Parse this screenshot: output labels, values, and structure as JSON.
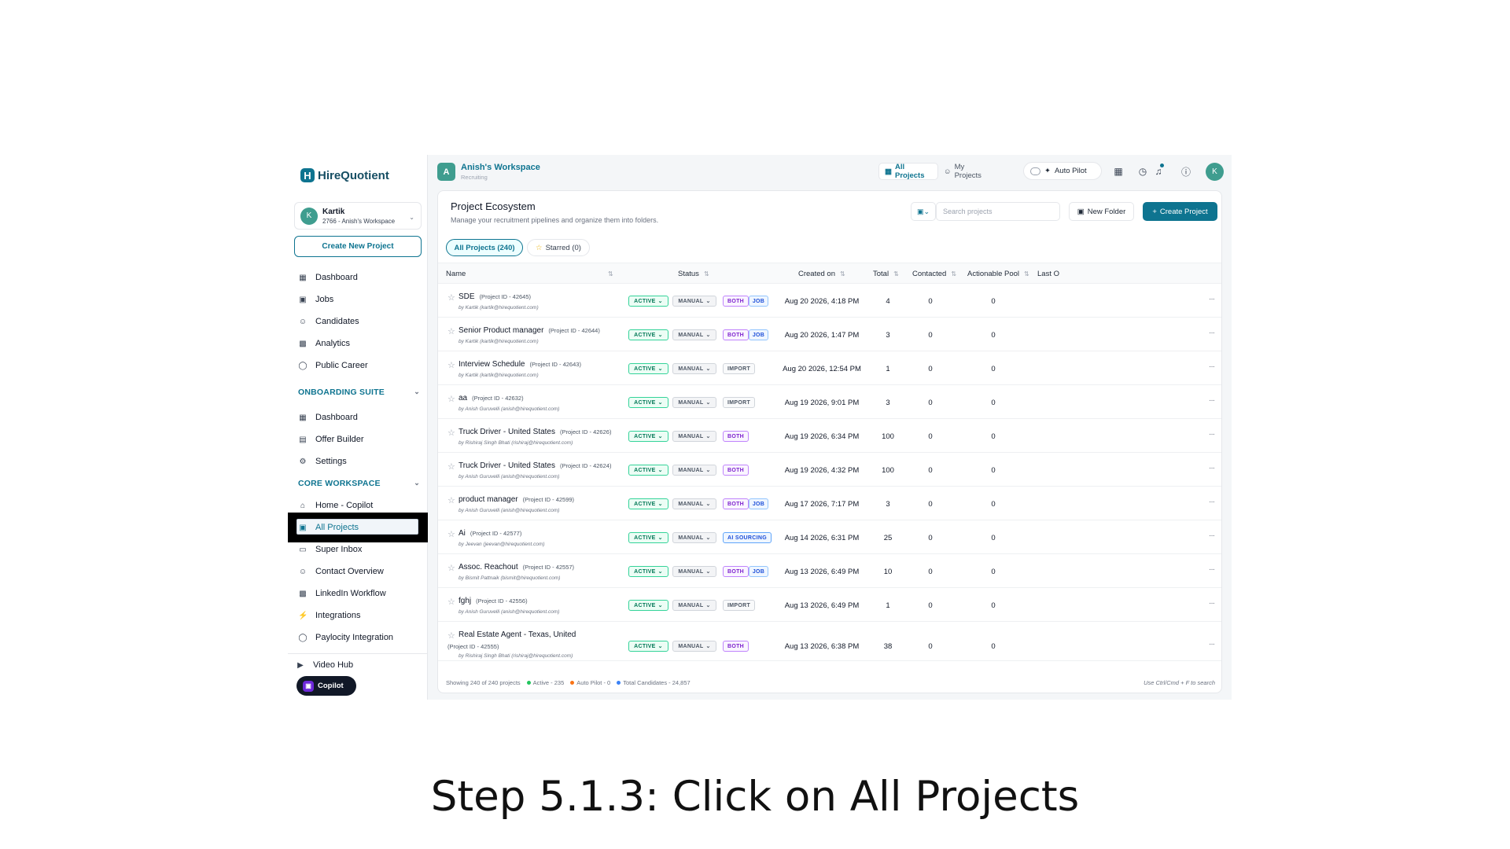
{
  "brand": {
    "name": "HireQuotient",
    "logo_letter": "H"
  },
  "account": {
    "avatar": "K",
    "name": "Kartik",
    "workspace": "2766 - Anish's Workspace"
  },
  "sidebar": {
    "create_button": "Create New Project",
    "main_items": [
      {
        "label": "Dashboard",
        "icon": "grid-icon"
      },
      {
        "label": "Jobs",
        "icon": "briefcase-icon"
      },
      {
        "label": "Candidates",
        "icon": "users-icon"
      },
      {
        "label": "Analytics",
        "icon": "bar-chart-icon"
      },
      {
        "label": "Public Career",
        "icon": "globe-icon"
      }
    ],
    "onboarding_title": "ONBOARDING SUITE",
    "onboarding_items": [
      {
        "label": "Dashboard",
        "icon": "grid-icon"
      },
      {
        "label": "Offer Builder",
        "icon": "document-icon"
      },
      {
        "label": "Settings",
        "icon": "gear-icon"
      }
    ],
    "core_title": "CORE WORKSPACE",
    "core_items": [
      {
        "label": "Home - Copilot",
        "icon": "home-icon"
      },
      {
        "label": "All Projects",
        "icon": "folder-icon",
        "active": true
      },
      {
        "label": "Super Inbox",
        "icon": "inbox-icon"
      },
      {
        "label": "Contact Overview",
        "icon": "contacts-icon"
      },
      {
        "label": "LinkedIn Workflow",
        "icon": "workflow-icon"
      },
      {
        "label": "Integrations",
        "icon": "plug-icon"
      },
      {
        "label": "Paylocity Integration",
        "icon": "globe-icon"
      }
    ],
    "video_hub": "Video Hub",
    "copilot": "Copilot"
  },
  "topbar": {
    "workspace_letter": "A",
    "workspace_title": "Anish's Workspace",
    "workspace_sub": "Recruiting",
    "view_all": "All Projects",
    "view_mine": "My Projects",
    "autopilot": "Auto Pilot",
    "user_avatar": "K"
  },
  "page": {
    "title": "Project Ecosystem",
    "subtitle": "Manage your recruitment pipelines and organize them into folders.",
    "search_placeholder": "Search projects",
    "new_folder": "New Folder",
    "create_project": "Create Project",
    "tab_all": "All Projects (240)",
    "tab_starred": "Starred (0)"
  },
  "table": {
    "headers": {
      "name": "Name",
      "status": "Status",
      "created": "Created on",
      "total": "Total",
      "contacted": "Contacted",
      "actionable": "Actionable Pool",
      "last": "Last O"
    },
    "rows": [
      {
        "name": "SDE",
        "pid": "(Project ID - 42645)",
        "by": "by Kartik (kartik@hirequotient.com)",
        "status": "ACTIVE",
        "mode": "MANUAL",
        "source": "BOTH",
        "job": "JOB",
        "created": "Aug 20 2026, 4:18 PM",
        "total": "4",
        "contacted": "0",
        "actionable": "0"
      },
      {
        "name": "Senior Product manager",
        "pid": "(Project ID - 42644)",
        "by": "by Kartik (kartik@hirequotient.com)",
        "status": "ACTIVE",
        "mode": "MANUAL",
        "source": "BOTH",
        "job": "JOB",
        "created": "Aug 20 2026, 1:47 PM",
        "total": "3",
        "contacted": "0",
        "actionable": "0"
      },
      {
        "name": "Interview Schedule",
        "pid": "(Project ID - 42643)",
        "by": "by Kartik (kartik@hirequotient.com)",
        "status": "ACTIVE",
        "mode": "MANUAL",
        "source": "IMPORT",
        "job": "",
        "created": "Aug 20 2026, 12:54 PM",
        "total": "1",
        "contacted": "0",
        "actionable": "0"
      },
      {
        "name": "aa",
        "pid": "(Project ID - 42632)",
        "by": "by Anish Guruvelli (anish@hirequotient.com)",
        "status": "ACTIVE",
        "mode": "MANUAL",
        "source": "IMPORT",
        "job": "",
        "created": "Aug 19 2026, 9:01 PM",
        "total": "3",
        "contacted": "0",
        "actionable": "0"
      },
      {
        "name": "Truck Driver - United States",
        "pid": "(Project ID - 42626)",
        "by": "by Rishiraj Singh Bhati (rishiraj@hirequotient.com)",
        "status": "ACTIVE",
        "mode": "MANUAL",
        "source": "BOTH",
        "job": "",
        "created": "Aug 19 2026, 6:34 PM",
        "total": "100",
        "contacted": "0",
        "actionable": "0"
      },
      {
        "name": "Truck Driver - United States",
        "pid": "(Project ID - 42624)",
        "by": "by Anish Guruvelli (anish@hirequotient.com)",
        "status": "ACTIVE",
        "mode": "MANUAL",
        "source": "BOTH",
        "job": "",
        "created": "Aug 19 2026, 4:32 PM",
        "total": "100",
        "contacted": "0",
        "actionable": "0"
      },
      {
        "name": "product manager",
        "pid": "(Project ID - 42599)",
        "by": "by Anish Guruvelli (anish@hirequotient.com)",
        "status": "ACTIVE",
        "mode": "MANUAL",
        "source": "BOTH",
        "job": "JOB",
        "created": "Aug 17 2026, 7:17 PM",
        "total": "3",
        "contacted": "0",
        "actionable": "0"
      },
      {
        "name": "Ai",
        "pid": "(Project ID - 42577)",
        "by": "by Jeevan (jeevan@hirequotient.com)",
        "status": "ACTIVE",
        "mode": "MANUAL",
        "source": "AI SOURCING",
        "job": "",
        "created": "Aug 14 2026, 6:31 PM",
        "total": "25",
        "contacted": "0",
        "actionable": "0"
      },
      {
        "name": "Assoc. Reachout",
        "pid": "(Project ID - 42557)",
        "by": "by Bismit Pattnaik (bismit@hirequotient.com)",
        "status": "ACTIVE",
        "mode": "MANUAL",
        "source": "BOTH",
        "job": "JOB",
        "created": "Aug 13 2026, 6:49 PM",
        "total": "10",
        "contacted": "0",
        "actionable": "0"
      },
      {
        "name": "fghj",
        "pid": "(Project ID - 42556)",
        "by": "by Anish Guruvelli (anish@hirequotient.com)",
        "status": "ACTIVE",
        "mode": "MANUAL",
        "source": "IMPORT",
        "job": "",
        "created": "Aug 13 2026, 6:49 PM",
        "total": "1",
        "contacted": "0",
        "actionable": "0"
      },
      {
        "name": "Real Estate Agent - Texas, United",
        "pid": "(Project ID - 42555)",
        "by": "by Rishiraj Singh Bhati (rishiraj@hirequotient.com)",
        "status": "ACTIVE",
        "mode": "MANUAL",
        "source": "BOTH",
        "job": "",
        "created": "Aug 13 2026, 6:38 PM",
        "total": "38",
        "contacted": "0",
        "actionable": "0"
      }
    ]
  },
  "footer": {
    "showing": "Showing 240 of 240 projects",
    "active": "Active - 235",
    "autopilot": "Auto Pilot - 0",
    "total_candidates": "Total Candidates - 24,857",
    "hint": "Use Ctrl/Cmd + F to search"
  },
  "caption": "Step 5.1.3: Click on All Projects"
}
